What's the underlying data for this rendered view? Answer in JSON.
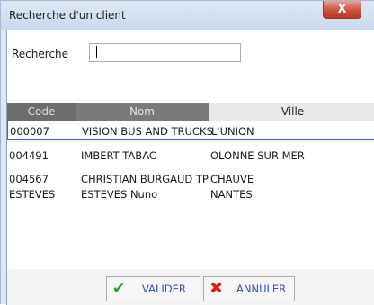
{
  "window": {
    "title": "Recherche d'un client",
    "close_glyph": "X"
  },
  "search": {
    "label": "Recherche",
    "value": ""
  },
  "table": {
    "columns": [
      "Code",
      "Nom",
      "Ville"
    ],
    "rows": [
      {
        "code": "000007",
        "nom": "VISION BUS AND TRUCKS",
        "ville": "L'UNION"
      },
      {
        "code": "004491",
        "nom": "IMBERT TABAC",
        "ville": "OLONNE SUR MER"
      },
      {
        "code": "004567",
        "nom": "CHRISTIAN BURGAUD TP",
        "ville": "CHAUVE"
      },
      {
        "code": "ESTEVES",
        "nom": "ESTEVES Nuno",
        "ville": "NANTES"
      }
    ]
  },
  "buttons": {
    "ok": {
      "label": "VALIDER",
      "icon": "check-icon"
    },
    "cancel": {
      "label": "ANNULER",
      "icon": "x-icon"
    }
  },
  "colors": {
    "header_bg": "#6d6d6d",
    "selection_border": "#2b6bc4",
    "button_text": "#2a53b3",
    "check": "#2f9e2f",
    "cross": "#d42020"
  }
}
